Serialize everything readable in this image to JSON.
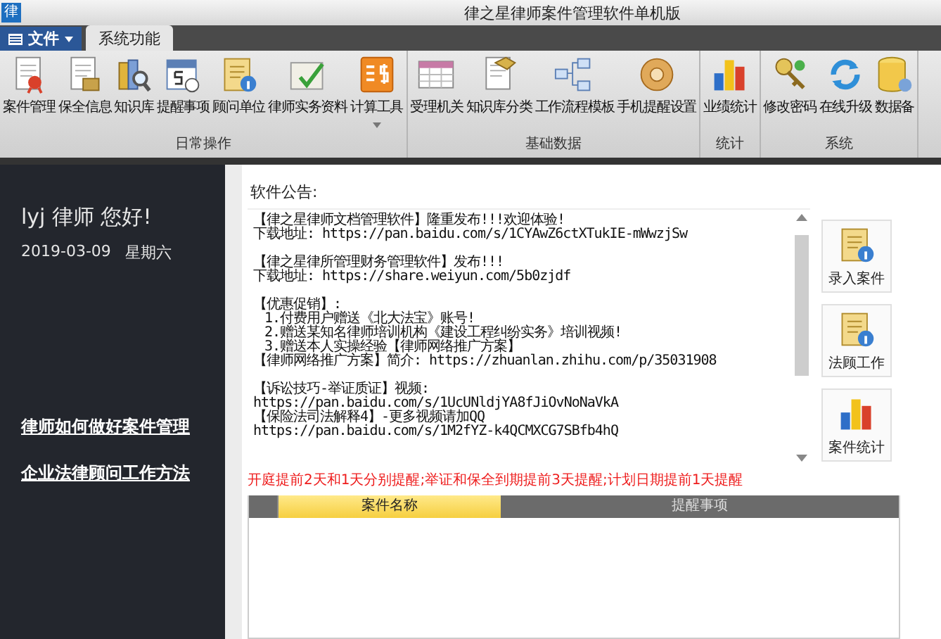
{
  "window": {
    "app_icon_text": "律",
    "title": "律之星律师案件管理软件单机版"
  },
  "tabs": [
    {
      "label": "文件",
      "kind": "menu",
      "selected": false
    },
    {
      "label": "系统功能",
      "kind": "tab",
      "selected": true
    }
  ],
  "ribbon": {
    "groups": [
      {
        "label": "日常操作",
        "buttons": [
          {
            "label": "案件管理"
          },
          {
            "label": "保全信息"
          },
          {
            "label": "知识库"
          },
          {
            "label": "提醒事项"
          },
          {
            "label": "顾问单位"
          },
          {
            "label": "律师实务资料"
          },
          {
            "label": "计算工具",
            "dropdown": true
          }
        ]
      },
      {
        "label": "基础数据",
        "buttons": [
          {
            "label": "受理机关"
          },
          {
            "label": "知识库分类"
          },
          {
            "label": "工作流程模板"
          },
          {
            "label": "手机提醒设置"
          }
        ]
      },
      {
        "label": "统计",
        "buttons": [
          {
            "label": "业绩统计"
          }
        ]
      },
      {
        "label": "系统",
        "buttons": [
          {
            "label": "修改密码"
          },
          {
            "label": "在线升级"
          },
          {
            "label": "数据备"
          }
        ]
      }
    ]
  },
  "sidebar": {
    "greeting": "lyj 律师 您好!",
    "date": "2019-03-09",
    "weekday": "星期六",
    "links": [
      "律师如何做好案件管理",
      "企业法律顾问工作方法"
    ]
  },
  "notice": {
    "title": "软件公告:",
    "paragraphs": [
      {
        "lines": [
          {
            "kind": "text",
            "text": "【律之星律师文档管理软件】隆重发布!!!欢迎体验!"
          },
          {
            "kind": "text",
            "text": "下载地址: https://pan.baidu.com/s/1CYAwZ6ctXTukIE-mWwzjSw"
          }
        ]
      },
      {
        "lines": [
          {
            "kind": "text",
            "text": "【律之星律所管理财务管理软件】发布!!!"
          },
          {
            "kind": "text",
            "text": "下载地址: https://share.weiyun.com/5b0zjdf"
          }
        ]
      },
      {
        "lines": [
          {
            "kind": "text",
            "text": "【优惠促销】:"
          },
          {
            "kind": "item",
            "text": "1.付费用户赠送《北大法宝》账号!"
          },
          {
            "kind": "item",
            "text": "2.赠送某知名律师培训机构《建设工程纠纷实务》培训视频!"
          },
          {
            "kind": "item",
            "text": "3.赠送本人实操经验【律师网络推广方案】"
          },
          {
            "kind": "text",
            "text": "【律师网络推广方案】简介: https://zhuanlan.zhihu.com/p/35031908"
          }
        ]
      },
      {
        "lines": [
          {
            "kind": "text",
            "text": "【诉讼技巧-举证质证】视频:"
          },
          {
            "kind": "text",
            "text": "https://pan.baidu.com/s/1UcUNldjYA8fJiOvNoNaVkA"
          },
          {
            "kind": "text",
            "text": "【保险法司法解释4】-更多视频请加QQ"
          },
          {
            "kind": "text",
            "text": "https://pan.baidu.com/s/1M2fYZ-k4QCMXCG7SBfb4hQ"
          }
        ]
      }
    ]
  },
  "side_buttons": [
    {
      "label": "录入案件"
    },
    {
      "label": "法顾工作"
    },
    {
      "label": "案件统计"
    }
  ],
  "reminder_note": "开庭提前2天和1天分别提醒;举证和保全到期提前3天提醒;计划日期提前1天提醒",
  "table": {
    "columns": [
      {
        "label": "案件名称",
        "selected": true
      },
      {
        "label": "提醒事项",
        "selected": false
      }
    ]
  }
}
